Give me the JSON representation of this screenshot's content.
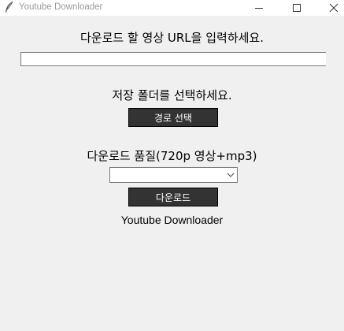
{
  "window": {
    "title": "Youtube Downloader",
    "icon": "feather-icon",
    "controls": [
      "minimize-icon",
      "maximize-icon",
      "close-icon"
    ]
  },
  "url_section": {
    "prompt": "다운로드 할 영상 URL을 입력하세요.",
    "input_value": ""
  },
  "folder_section": {
    "prompt": "저장 폴더를 선택하세요.",
    "button_label": "경로 선택"
  },
  "quality_section": {
    "prompt": "다운로드 품질(720p 영상+mp3)",
    "selected_value": ""
  },
  "download_button_label": "다운로드",
  "footer_text": "Youtube Downloader",
  "colors": {
    "background": "#f0f0f0",
    "button_bg": "#333333",
    "button_text": "#ffffff"
  }
}
